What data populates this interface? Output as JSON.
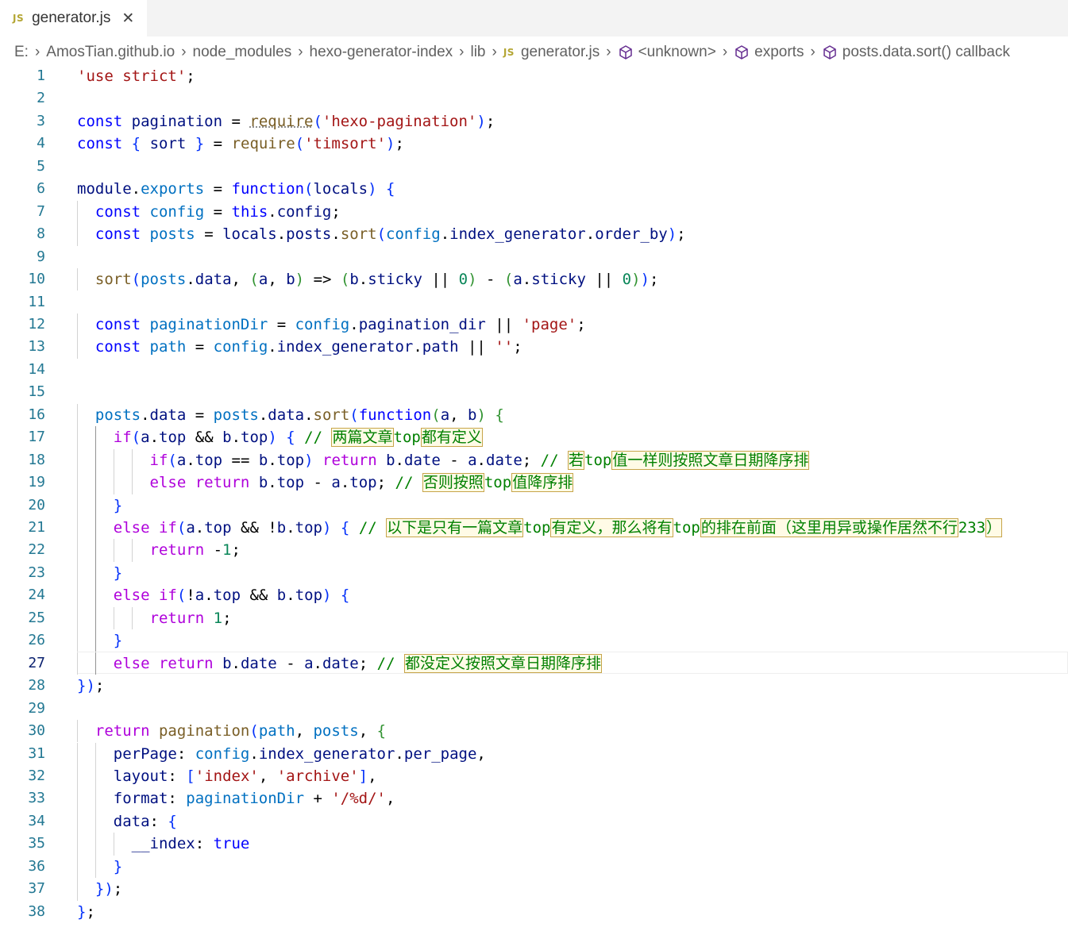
{
  "tab": {
    "badge": "JS",
    "title": "generator.js",
    "close": "✕"
  },
  "breadcrumb": {
    "items": [
      "E:",
      "AmosTian.github.io",
      "node_modules",
      "hexo-generator-index",
      "lib"
    ],
    "file_badge": "JS",
    "file": "generator.js",
    "symbols": [
      "<unknown>",
      "exports",
      "posts.data.sort() callback"
    ],
    "separator": "›"
  },
  "editor": {
    "active_line": 27,
    "lines": [
      {
        "n": "1",
        "t": "'use strict';"
      },
      {
        "n": "2",
        "t": ""
      },
      {
        "n": "3",
        "t": "const pagination = require('hexo-pagination');"
      },
      {
        "n": "4",
        "t": "const { sort } = require('timsort');"
      },
      {
        "n": "5",
        "t": ""
      },
      {
        "n": "6",
        "t": "module.exports = function(locals) {"
      },
      {
        "n": "7",
        "t": "  const config = this.config;"
      },
      {
        "n": "8",
        "t": "  const posts = locals.posts.sort(config.index_generator.order_by);"
      },
      {
        "n": "9",
        "t": ""
      },
      {
        "n": "10",
        "t": "  sort(posts.data, (a, b) => (b.sticky || 0) - (a.sticky || 0));"
      },
      {
        "n": "11",
        "t": ""
      },
      {
        "n": "12",
        "t": "  const paginationDir = config.pagination_dir || 'page';"
      },
      {
        "n": "13",
        "t": "  const path = config.index_generator.path || '';"
      },
      {
        "n": "14",
        "t": ""
      },
      {
        "n": "15",
        "t": ""
      },
      {
        "n": "16",
        "t": "  posts.data = posts.data.sort(function(a, b) {"
      },
      {
        "n": "17",
        "t": "    if(a.top && b.top) { // 两篇文章top都有定义"
      },
      {
        "n": "18",
        "t": "        if(a.top == b.top) return b.date - a.date; // 若top值一样则按照文章日期降序排"
      },
      {
        "n": "19",
        "t": "        else return b.top - a.top; // 否则按照top值降序排"
      },
      {
        "n": "20",
        "t": "    }"
      },
      {
        "n": "21",
        "t": "    else if(a.top && !b.top) { // 以下是只有一篇文章top有定义，那么将有top的排在前面（这里用异或操作居然不行233）"
      },
      {
        "n": "22",
        "t": "        return -1;"
      },
      {
        "n": "23",
        "t": "    }"
      },
      {
        "n": "24",
        "t": "    else if(!a.top && b.top) {"
      },
      {
        "n": "25",
        "t": "        return 1;"
      },
      {
        "n": "26",
        "t": "    }"
      },
      {
        "n": "27",
        "t": "    else return b.date - a.date; // 都没定义按照文章日期降序排"
      },
      {
        "n": "28",
        "t": "});"
      },
      {
        "n": "29",
        "t": ""
      },
      {
        "n": "30",
        "t": "  return pagination(path, posts, {"
      },
      {
        "n": "31",
        "t": "    perPage: config.index_generator.per_page,"
      },
      {
        "n": "32",
        "t": "    layout: ['index', 'archive'],"
      },
      {
        "n": "33",
        "t": "    format: paginationDir + '/%d/',"
      },
      {
        "n": "34",
        "t": "    data: {"
      },
      {
        "n": "35",
        "t": "      __index: true"
      },
      {
        "n": "36",
        "t": "    }"
      },
      {
        "n": "37",
        "t": "  });"
      },
      {
        "n": "38",
        "t": "};"
      }
    ]
  },
  "colors": {
    "keyword": "#0000ff",
    "control": "#af00db",
    "function": "#795e26",
    "string": "#a31515",
    "variable": "#001080",
    "constant": "#0070c1",
    "number": "#098658",
    "comment": "#008000",
    "line_number": "#237893"
  }
}
